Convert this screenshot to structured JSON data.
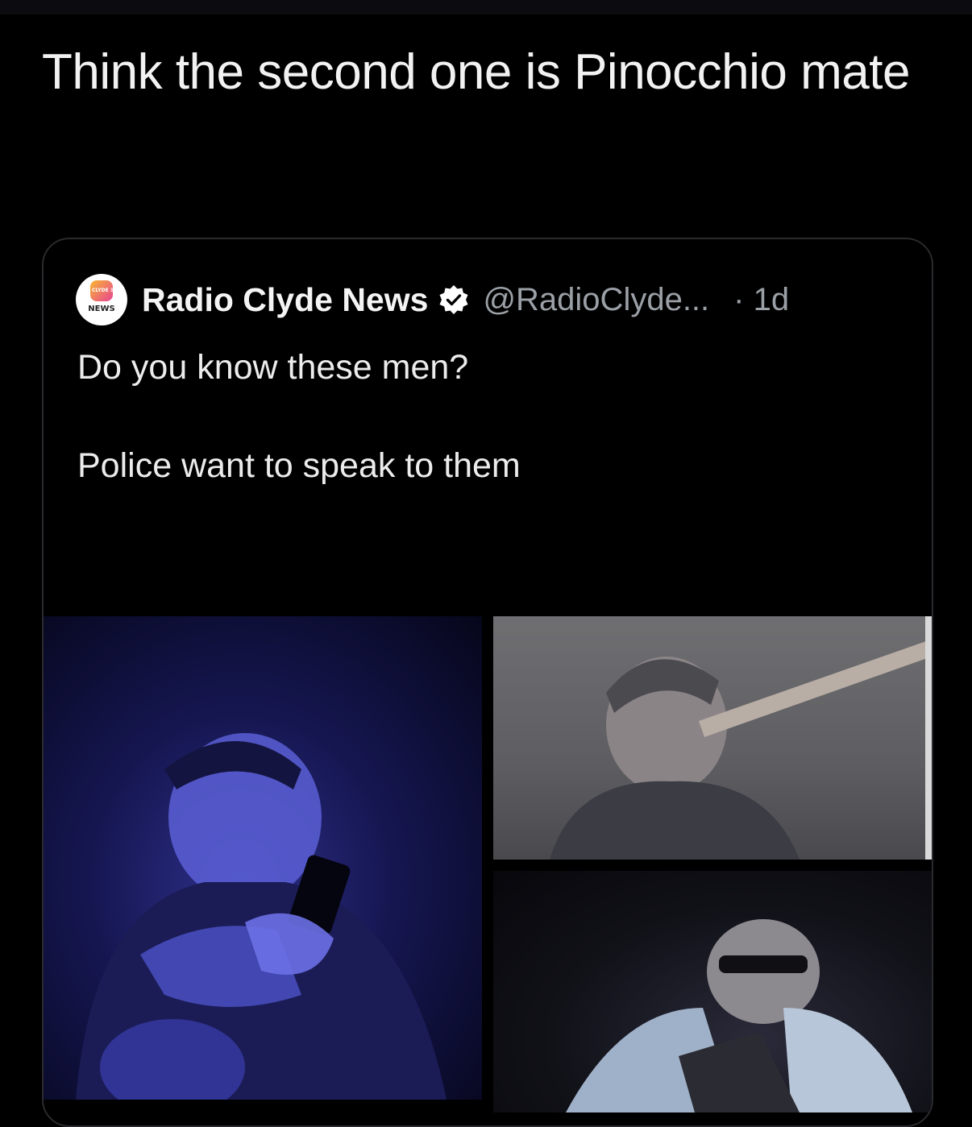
{
  "post": {
    "text": "Think the second one is Pinocchio mate"
  },
  "quoted_tweet": {
    "display_name": "Radio Clyde News",
    "handle": "@RadioClyde...",
    "time": "· 1d",
    "avatar_logo_text": "NEWS",
    "body_line_1": "Do you know these men?",
    "body_line_2": "Police want to speak to them",
    "media": [
      {
        "label": "cctv-photo-man-with-phone"
      },
      {
        "label": "cctv-photo-man-with-long-nose"
      },
      {
        "label": "cctv-photo-man-with-glasses"
      }
    ]
  },
  "colors": {
    "background": "#000000",
    "muted_text": "#9aa0a6",
    "verified_badge": "#ffffff"
  }
}
